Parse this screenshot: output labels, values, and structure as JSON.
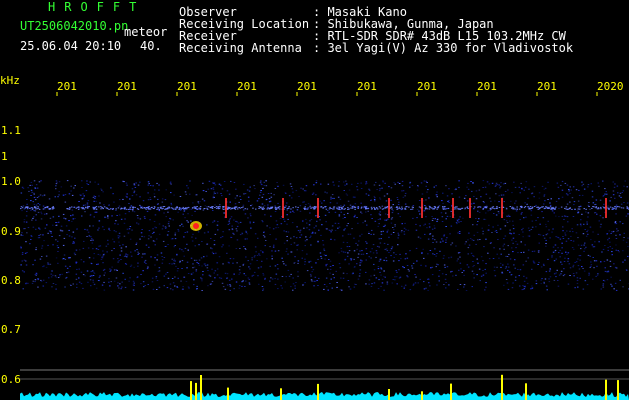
{
  "header": {
    "brand": "HROFFT",
    "filename": "UT2506042010.pn",
    "type_tag": "meteor",
    "timestamp": "25.06.04 20:10",
    "count": "40.",
    "fields": [
      {
        "label": "Observer",
        "value": ": Masaki Kano"
      },
      {
        "label": "Receiving Location",
        "value": ": Shibukawa, Gunma, Japan"
      },
      {
        "label": "Receiver",
        "value": ": RTL-SDR SDR# 43dB L15 103.2MHz CW"
      },
      {
        "label": "Receiving Antenna",
        "value": ": 3el Yagi(V) Az 330 for Vladivostok"
      }
    ]
  },
  "axis": {
    "unit": "kHz",
    "x_ticks": [
      "201",
      "201",
      "201",
      "201",
      "201",
      "201",
      "201",
      "201",
      "201",
      "2020"
    ],
    "y_ticks": [
      "1.1",
      "1",
      "1.0",
      "0.9",
      "0.8",
      "0.7",
      "0.6"
    ]
  },
  "colors": {
    "text": "#ffffff",
    "brand": "#33ff33",
    "axis": "#ffff00",
    "signal": "#2b3cff",
    "signal_hot": "#ff3030",
    "level": "#00e5ff"
  }
}
